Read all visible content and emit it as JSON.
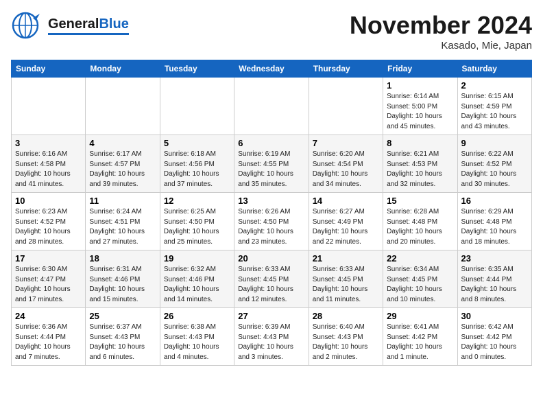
{
  "header": {
    "logo_general": "General",
    "logo_blue": "Blue",
    "month_title": "November 2024",
    "location": "Kasado, Mie, Japan"
  },
  "days_of_week": [
    "Sunday",
    "Monday",
    "Tuesday",
    "Wednesday",
    "Thursday",
    "Friday",
    "Saturday"
  ],
  "weeks": [
    [
      {
        "day": "",
        "info": ""
      },
      {
        "day": "",
        "info": ""
      },
      {
        "day": "",
        "info": ""
      },
      {
        "day": "",
        "info": ""
      },
      {
        "day": "",
        "info": ""
      },
      {
        "day": "1",
        "info": "Sunrise: 6:14 AM\nSunset: 5:00 PM\nDaylight: 10 hours and 45 minutes."
      },
      {
        "day": "2",
        "info": "Sunrise: 6:15 AM\nSunset: 4:59 PM\nDaylight: 10 hours and 43 minutes."
      }
    ],
    [
      {
        "day": "3",
        "info": "Sunrise: 6:16 AM\nSunset: 4:58 PM\nDaylight: 10 hours and 41 minutes."
      },
      {
        "day": "4",
        "info": "Sunrise: 6:17 AM\nSunset: 4:57 PM\nDaylight: 10 hours and 39 minutes."
      },
      {
        "day": "5",
        "info": "Sunrise: 6:18 AM\nSunset: 4:56 PM\nDaylight: 10 hours and 37 minutes."
      },
      {
        "day": "6",
        "info": "Sunrise: 6:19 AM\nSunset: 4:55 PM\nDaylight: 10 hours and 35 minutes."
      },
      {
        "day": "7",
        "info": "Sunrise: 6:20 AM\nSunset: 4:54 PM\nDaylight: 10 hours and 34 minutes."
      },
      {
        "day": "8",
        "info": "Sunrise: 6:21 AM\nSunset: 4:53 PM\nDaylight: 10 hours and 32 minutes."
      },
      {
        "day": "9",
        "info": "Sunrise: 6:22 AM\nSunset: 4:52 PM\nDaylight: 10 hours and 30 minutes."
      }
    ],
    [
      {
        "day": "10",
        "info": "Sunrise: 6:23 AM\nSunset: 4:52 PM\nDaylight: 10 hours and 28 minutes."
      },
      {
        "day": "11",
        "info": "Sunrise: 6:24 AM\nSunset: 4:51 PM\nDaylight: 10 hours and 27 minutes."
      },
      {
        "day": "12",
        "info": "Sunrise: 6:25 AM\nSunset: 4:50 PM\nDaylight: 10 hours and 25 minutes."
      },
      {
        "day": "13",
        "info": "Sunrise: 6:26 AM\nSunset: 4:50 PM\nDaylight: 10 hours and 23 minutes."
      },
      {
        "day": "14",
        "info": "Sunrise: 6:27 AM\nSunset: 4:49 PM\nDaylight: 10 hours and 22 minutes."
      },
      {
        "day": "15",
        "info": "Sunrise: 6:28 AM\nSunset: 4:48 PM\nDaylight: 10 hours and 20 minutes."
      },
      {
        "day": "16",
        "info": "Sunrise: 6:29 AM\nSunset: 4:48 PM\nDaylight: 10 hours and 18 minutes."
      }
    ],
    [
      {
        "day": "17",
        "info": "Sunrise: 6:30 AM\nSunset: 4:47 PM\nDaylight: 10 hours and 17 minutes."
      },
      {
        "day": "18",
        "info": "Sunrise: 6:31 AM\nSunset: 4:46 PM\nDaylight: 10 hours and 15 minutes."
      },
      {
        "day": "19",
        "info": "Sunrise: 6:32 AM\nSunset: 4:46 PM\nDaylight: 10 hours and 14 minutes."
      },
      {
        "day": "20",
        "info": "Sunrise: 6:33 AM\nSunset: 4:45 PM\nDaylight: 10 hours and 12 minutes."
      },
      {
        "day": "21",
        "info": "Sunrise: 6:33 AM\nSunset: 4:45 PM\nDaylight: 10 hours and 11 minutes."
      },
      {
        "day": "22",
        "info": "Sunrise: 6:34 AM\nSunset: 4:45 PM\nDaylight: 10 hours and 10 minutes."
      },
      {
        "day": "23",
        "info": "Sunrise: 6:35 AM\nSunset: 4:44 PM\nDaylight: 10 hours and 8 minutes."
      }
    ],
    [
      {
        "day": "24",
        "info": "Sunrise: 6:36 AM\nSunset: 4:44 PM\nDaylight: 10 hours and 7 minutes."
      },
      {
        "day": "25",
        "info": "Sunrise: 6:37 AM\nSunset: 4:43 PM\nDaylight: 10 hours and 6 minutes."
      },
      {
        "day": "26",
        "info": "Sunrise: 6:38 AM\nSunset: 4:43 PM\nDaylight: 10 hours and 4 minutes."
      },
      {
        "day": "27",
        "info": "Sunrise: 6:39 AM\nSunset: 4:43 PM\nDaylight: 10 hours and 3 minutes."
      },
      {
        "day": "28",
        "info": "Sunrise: 6:40 AM\nSunset: 4:43 PM\nDaylight: 10 hours and 2 minutes."
      },
      {
        "day": "29",
        "info": "Sunrise: 6:41 AM\nSunset: 4:42 PM\nDaylight: 10 hours and 1 minute."
      },
      {
        "day": "30",
        "info": "Sunrise: 6:42 AM\nSunset: 4:42 PM\nDaylight: 10 hours and 0 minutes."
      }
    ]
  ]
}
